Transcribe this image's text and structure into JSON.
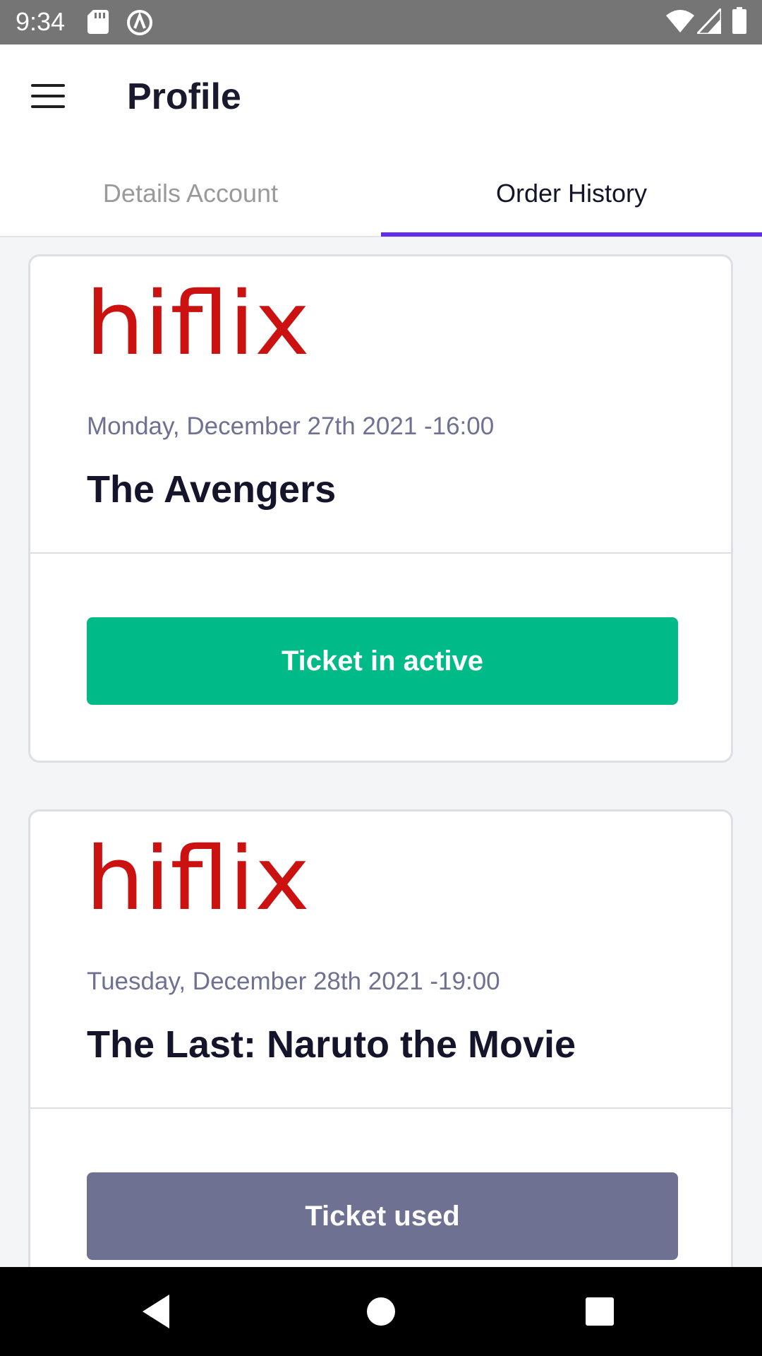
{
  "status_bar": {
    "time": "9:34",
    "icons": [
      "sd-card-icon",
      "vpn-icon",
      "wifi-icon",
      "signal-icon",
      "battery-icon"
    ]
  },
  "header": {
    "menu_icon": "hamburger-menu-icon",
    "title": "Profile"
  },
  "tabs": [
    {
      "label": "Details Account",
      "selected": false
    },
    {
      "label": "Order History",
      "selected": true
    }
  ],
  "colors": {
    "accent": "#5f2eea",
    "brand_red": "#cc1111",
    "active_button": "#00ba88",
    "used_button": "#6e7191"
  },
  "orders": [
    {
      "brand": "hiflix",
      "datetime": "Monday, December 27th 2021 -16:00",
      "movie": "The Avengers",
      "status_label": "Ticket in active"
    },
    {
      "brand": "hiflix",
      "datetime": "Tuesday, December 28th 2021 -19:00",
      "movie": "The Last: Naruto the Movie",
      "status_label": "Ticket used"
    }
  ],
  "nav": [
    "back-icon",
    "home-icon",
    "recents-icon"
  ]
}
